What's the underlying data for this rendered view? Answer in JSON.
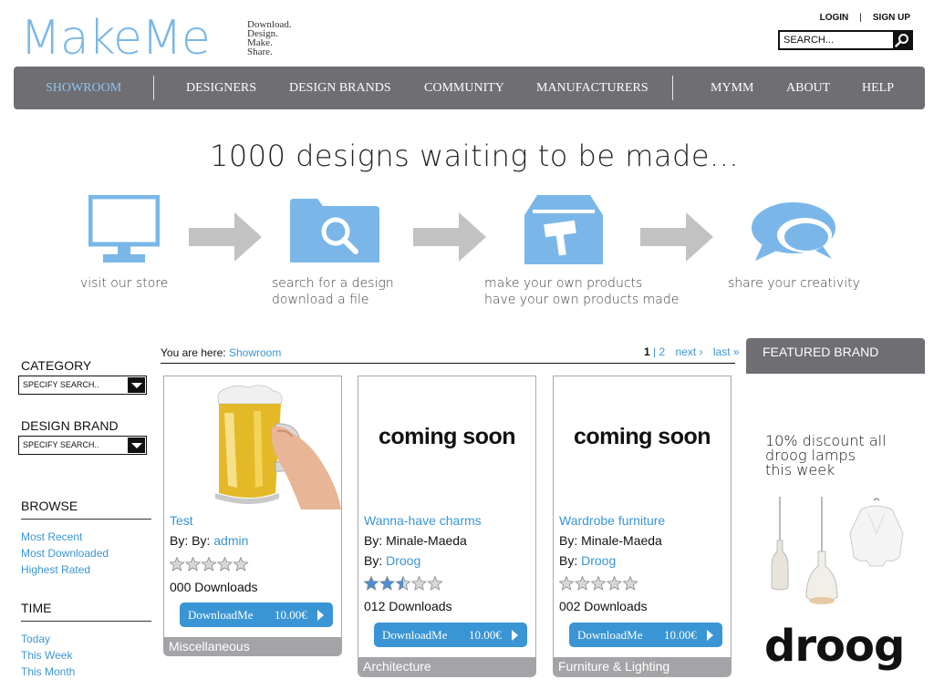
{
  "brand": {
    "logo": "MakeMe",
    "tagline": [
      "Download.",
      "Design.",
      "Make.",
      "Share."
    ],
    "color": "#7ab7e8"
  },
  "toplinks": {
    "login": "LOGIN",
    "separator": "|",
    "signup": "SIGN UP"
  },
  "search": {
    "placeholder": "SEARCH...",
    "icon": "magnifier-icon"
  },
  "nav": {
    "items": [
      {
        "label": "SHOWROOM",
        "active": true
      },
      {
        "label": "DESIGNERS"
      },
      {
        "label": "DESIGN BRANDS"
      },
      {
        "label": "COMMUNITY"
      },
      {
        "label": "MANUFACTURERS"
      },
      {
        "label": "MYMM"
      },
      {
        "label": "ABOUT"
      },
      {
        "label": "HELP"
      }
    ],
    "background": "#6e6e73",
    "active_color": "#8ec4ef"
  },
  "hero": {
    "title": "1000 designs waiting to be made...",
    "steps": [
      {
        "icon": "monitor-icon",
        "lines": [
          "visit our store"
        ]
      },
      {
        "icon": "folder-search-icon",
        "lines": [
          "search for a design",
          "download a file"
        ]
      },
      {
        "icon": "toolbox-hammer-icon",
        "lines": [
          "make your own products",
          "have your own products made"
        ]
      },
      {
        "icon": "speech-bubbles-icon",
        "lines": [
          "share your creativity"
        ]
      }
    ],
    "icon_color": "#7ab7e8",
    "arrow_color": "#c2c2c2"
  },
  "sidebar": {
    "category": {
      "heading": "CATEGORY",
      "select": "SPECIFY SEARCH.."
    },
    "design_brand": {
      "heading": "DESIGN BRAND",
      "select": "SPECIFY SEARCH.."
    },
    "browse": {
      "heading": "BROWSE",
      "links": [
        "Most Recent",
        "Most Downloaded",
        "Highest Rated"
      ]
    },
    "time": {
      "heading": "TIME",
      "links": [
        "Today",
        "This Week",
        "This Month"
      ]
    }
  },
  "breadcrumb": {
    "prefix": "You are here:",
    "current": "Showroom"
  },
  "pager": {
    "current": "1",
    "separator": "|",
    "page2": "2",
    "next": "next ›",
    "last": "last »"
  },
  "products": [
    {
      "title": "Test",
      "by_label": "By:",
      "by_value": "By: admin",
      "by_prefix": "By: ",
      "by_link": "admin",
      "rating": 0,
      "downloads": "000 Downloads",
      "button": "DownloadMe",
      "price": "10.00€",
      "category": "Miscellaneous",
      "image": "beer-mug-image"
    },
    {
      "title": "Wanna-have charms",
      "by_label": "By:",
      "by_value": "Minale-Maeda",
      "second_by_label": "By:",
      "second_by_link": "Droog",
      "rating": 2.5,
      "downloads": "012 Downloads",
      "button": "DownloadMe",
      "price": "10.00€",
      "category": "Architecture",
      "image_text": "coming soon"
    },
    {
      "title": "Wardrobe furniture",
      "by_label": "By:",
      "by_value": "Minale-Maeda",
      "second_by_label": "By:",
      "second_by_link": "Droog",
      "rating": 0,
      "downloads": "002 Downloads",
      "button": "DownloadMe",
      "price": "10.00€",
      "category": "Furniture & Lighting",
      "image_text": "coming soon"
    }
  ],
  "featured": {
    "heading": "FEATURED BRAND",
    "text_lines": [
      "10% discount all",
      "droog lamps",
      "this week"
    ],
    "logo": "droog"
  }
}
